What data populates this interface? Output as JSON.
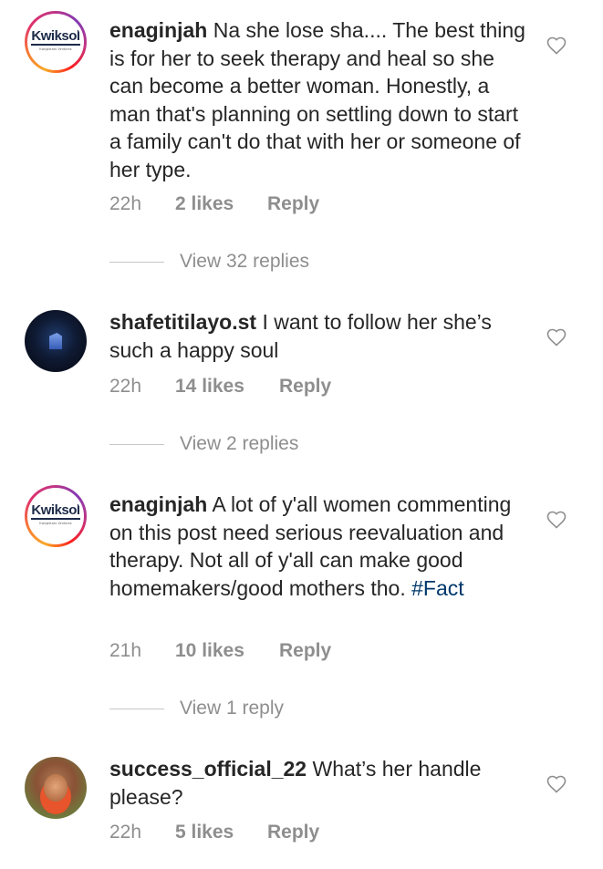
{
  "comments": [
    {
      "username": "enaginjah",
      "text": "Na she lose sha.... The best thing is for her to seek therapy and heal so she can become a better woman. Honestly, a man that's planning on settling down to start a family can't do that with her or someone of her type.",
      "hashtag": "",
      "time": "22h",
      "likes": "2 likes",
      "reply": "Reply",
      "view_replies": "View 32 replies",
      "avatar_logo": "Kwiksol",
      "avatar_logo_sub": "Kwiqklears Ventures"
    },
    {
      "username": "shafetitilayo.st",
      "text": "I want to follow her she’s such a happy soul",
      "hashtag": "",
      "time": "22h",
      "likes": "14 likes",
      "reply": "Reply",
      "view_replies": "View 2 replies"
    },
    {
      "username": "enaginjah",
      "text": "A lot of y'all women commenting on this post need serious reevaluation and therapy. Not all of y'all can make good homemakers/good mothers tho. ",
      "hashtag": "#Fact",
      "time": "21h",
      "likes": "10 likes",
      "reply": "Reply",
      "view_replies": "View 1 reply",
      "avatar_logo": "Kwiksol",
      "avatar_logo_sub": "Kwiqklears Ventures"
    },
    {
      "username": "success_official_22",
      "text": "What’s her handle please?",
      "hashtag": "",
      "time": "22h",
      "likes": "5 likes",
      "reply": "Reply"
    }
  ],
  "colors": {
    "text": "#262626",
    "muted": "#8e8e8e",
    "hashtag": "#00376b",
    "line": "#c7c7c7"
  },
  "icons": {
    "like": "heart-outline-icon"
  }
}
